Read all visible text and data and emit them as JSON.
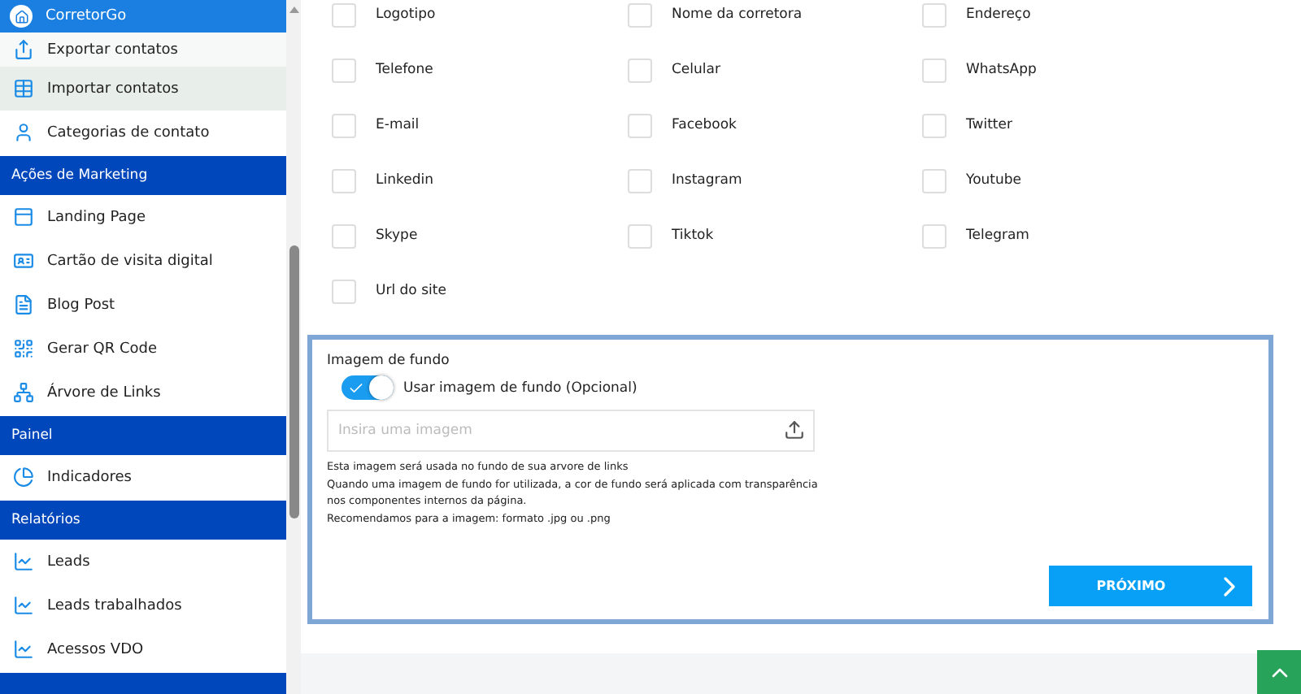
{
  "sidebar": {
    "items": [
      {
        "kind": "header",
        "label": "CorretorGo"
      },
      {
        "kind": "item",
        "label": "Exportar contatos",
        "selected": false
      },
      {
        "kind": "item",
        "label": "Importar contatos",
        "selected": true
      },
      {
        "kind": "item",
        "label": "Categorias de contato",
        "selected": false
      },
      {
        "kind": "section",
        "label": "Ações de Marketing"
      },
      {
        "kind": "item",
        "label": "Landing Page",
        "selected": false
      },
      {
        "kind": "item",
        "label": "Cartão de visita digital",
        "selected": false
      },
      {
        "kind": "item",
        "label": "Blog Post",
        "selected": false
      },
      {
        "kind": "item",
        "label": "Gerar QR Code",
        "selected": false
      },
      {
        "kind": "item",
        "label": "Árvore de Links",
        "selected": false
      },
      {
        "kind": "section",
        "label": "Painel"
      },
      {
        "kind": "item",
        "label": "Indicadores",
        "selected": false
      },
      {
        "kind": "section",
        "label": "Relatórios"
      },
      {
        "kind": "item",
        "label": "Leads",
        "selected": false
      },
      {
        "kind": "item",
        "label": "Leads trabalhados",
        "selected": false
      },
      {
        "kind": "item",
        "label": "Acessos VDO",
        "selected": false
      }
    ]
  },
  "fields": [
    {
      "label": "Logotipo",
      "checked": false
    },
    {
      "label": "Nome da corretora",
      "checked": false
    },
    {
      "label": "Endereço",
      "checked": false
    },
    {
      "label": "Telefone",
      "checked": false
    },
    {
      "label": "Celular",
      "checked": false
    },
    {
      "label": "WhatsApp",
      "checked": false
    },
    {
      "label": "E-mail",
      "checked": false
    },
    {
      "label": "Facebook",
      "checked": false
    },
    {
      "label": "Twitter",
      "checked": false
    },
    {
      "label": "Linkedin",
      "checked": false
    },
    {
      "label": "Instagram",
      "checked": false
    },
    {
      "label": "Youtube",
      "checked": false
    },
    {
      "label": "Skype",
      "checked": false
    },
    {
      "label": "Tiktok",
      "checked": false
    },
    {
      "label": "Telegram",
      "checked": false
    },
    {
      "label": "Url do site",
      "checked": false
    }
  ],
  "background": {
    "title": "Imagem de fundo",
    "toggle": {
      "label": "Usar imagem de fundo (Opcional)",
      "on": true
    },
    "upload": {
      "placeholder": "Insira uma imagem"
    },
    "notes": [
      "Esta imagem será usada no fundo de sua arvore de links",
      "Quando uma imagem de fundo for utilizada, a cor de fundo será aplicada com transparência nos componentes internos da página.",
      "Recomendamos para a imagem: formato .jpg ou .png"
    ]
  },
  "next_button": {
    "label": "PRÓXIMO"
  }
}
